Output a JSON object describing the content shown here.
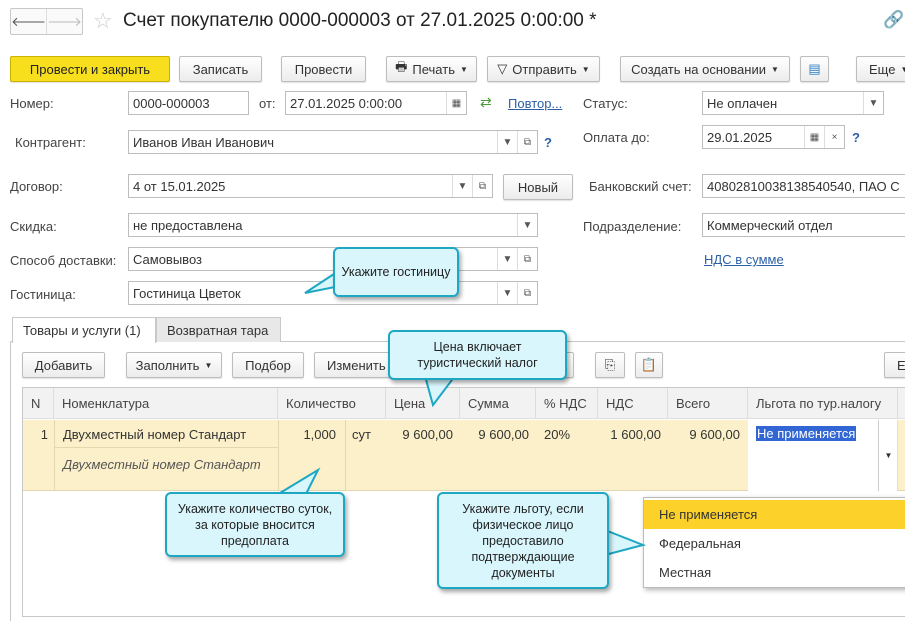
{
  "header": {
    "title": "Счет покупателю 0000-000003 от 27.01.2025 0:00:00 *"
  },
  "toolbar": {
    "post_close": "Провести и закрыть",
    "save": "Записать",
    "post": "Провести",
    "print": "Печать",
    "send": "Отправить",
    "create_based": "Создать на основании",
    "more": "Еще"
  },
  "form": {
    "number_label": "Номер:",
    "number": "0000-000003",
    "date_label": "от:",
    "date": "27.01.2025  0:00:00",
    "repeat_link": "Повтор...",
    "status_label": "Статус:",
    "status": "Не оплачен",
    "counterparty_label": "Контрагент:",
    "counterparty": "Иванов Иван Иванович",
    "pay_until_label": "Оплата до:",
    "pay_until": "29.01.2025",
    "contract_label": "Договор:",
    "contract": "4 от 15.01.2025",
    "new_button": "Новый",
    "bank_label": "Банковский счет:",
    "bank": "40802810038138540540, ПАО С",
    "discount_label": "Скидка:",
    "discount": "не предоставлена",
    "department_label": "Подразделение:",
    "department": "Коммерческий отдел",
    "delivery_label": "Способ доставки:",
    "delivery": "Самовывоз",
    "vat_link": "НДС в сумме",
    "hotel_label": "Гостиница:",
    "hotel": "Гостиница Цветок",
    "help": "?"
  },
  "tabs": [
    {
      "label": "Товары и услуги (1)",
      "active": true
    },
    {
      "label": "Возвратная тара",
      "active": false
    }
  ],
  "table_toolbar": {
    "add": "Добавить",
    "fill": "Заполнить",
    "pick": "Подбор",
    "edit": "Изменить",
    "right": "Е"
  },
  "table": {
    "columns": [
      "N",
      "Номенклатура",
      "Количество",
      "Цена",
      "Сумма",
      "% НДС",
      "НДС",
      "Всего",
      "Льгота по тур.налогу"
    ],
    "rows": [
      {
        "n": "1",
        "item": "Двухместный номер Стандарт",
        "item_desc": "Двухместный номер Стандарт",
        "qty": "1,000",
        "unit": "сут",
        "price": "9 600,00",
        "sum": "9 600,00",
        "vat_rate": "20%",
        "vat": "1 600,00",
        "total": "9 600,00",
        "benefit": "Не применяется"
      }
    ]
  },
  "dropdown": {
    "options": [
      "Не применяется",
      "Федеральная",
      "Местная"
    ],
    "selected": "Не применяется"
  },
  "callouts": {
    "hotel": "Укажите гостиницу",
    "price": "Цена включает туристический налог",
    "qty": "Укажите количество суток, за которые вносится предоплата",
    "benefit": "Укажите льготу, если физическое лицо предоставило подтверждающие документы"
  },
  "colors": {
    "primary": "#f7df1d",
    "callout_bg": "#d8f6fc",
    "callout_border": "#1ea7c2",
    "row_bg": "#fbf0c9",
    "highlight": "#fcd12a",
    "selection": "#3166d4"
  }
}
